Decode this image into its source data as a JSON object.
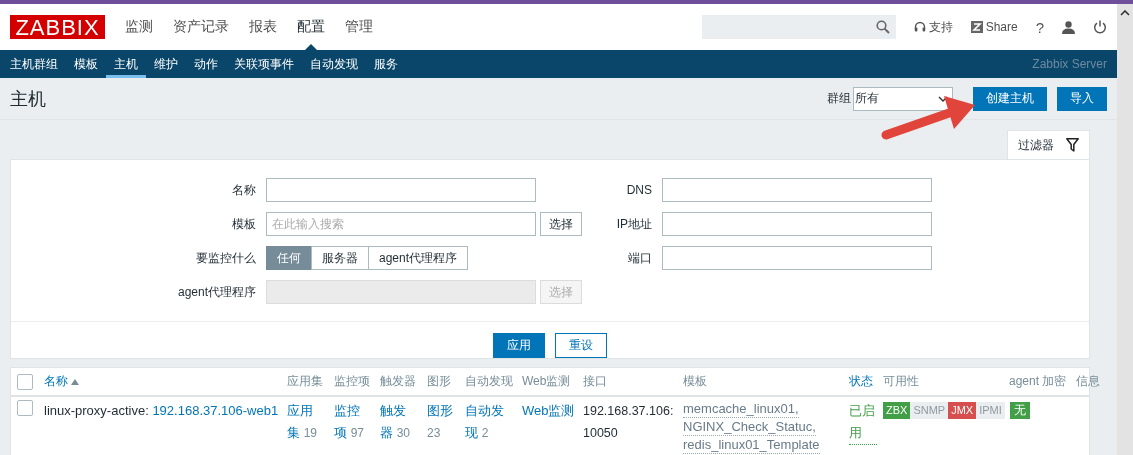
{
  "top_nav": {
    "logo": "ZABBIX",
    "menu": [
      {
        "label": "监测",
        "selected": false
      },
      {
        "label": "资产记录",
        "selected": false
      },
      {
        "label": "报表",
        "selected": false
      },
      {
        "label": "配置",
        "selected": true
      },
      {
        "label": "管理",
        "selected": false
      }
    ],
    "support": "支持",
    "share": "Share",
    "help": "?"
  },
  "sub_nav": {
    "items": [
      {
        "label": "主机群组",
        "selected": false
      },
      {
        "label": "模板",
        "selected": false
      },
      {
        "label": "主机",
        "selected": true
      },
      {
        "label": "维护",
        "selected": false
      },
      {
        "label": "动作",
        "selected": false
      },
      {
        "label": "关联项事件",
        "selected": false
      },
      {
        "label": "自动发现",
        "selected": false
      },
      {
        "label": "服务",
        "selected": false
      }
    ],
    "server_name": "Zabbix Server"
  },
  "page": {
    "title": "主机",
    "group_label": "群组",
    "group_value": "所有",
    "buttons": [
      "创建主机",
      "导入"
    ]
  },
  "filter": {
    "tab": "过滤器",
    "left": [
      {
        "kind": "text",
        "label": "名称"
      },
      {
        "kind": "picker",
        "label": "模板",
        "placeholder": "在此输入搜索",
        "button": "选择",
        "disabled": false
      },
      {
        "kind": "segments",
        "label": "要监控什么",
        "options": [
          {
            "label": "任何",
            "selected": true
          },
          {
            "label": "服务器",
            "selected": false
          },
          {
            "label": "agent代理程序",
            "selected": false
          }
        ]
      },
      {
        "kind": "picker",
        "label": "agent代理程序",
        "button": "选择",
        "disabled": true
      }
    ],
    "right": [
      {
        "kind": "text",
        "label": "DNS"
      },
      {
        "kind": "text",
        "label": "IP地址"
      },
      {
        "kind": "text",
        "label": "端口"
      }
    ],
    "apply": "应用",
    "reset": "重设"
  },
  "table": {
    "select_all_checked": false,
    "columns": [
      {
        "label": "名称",
        "sortable": true,
        "sorted": true
      },
      {
        "label": "应用集",
        "sortable": false,
        "sorted": false
      },
      {
        "label": "监控项",
        "sortable": false,
        "sorted": false
      },
      {
        "label": "触发器",
        "sortable": false,
        "sorted": false
      },
      {
        "label": "图形",
        "sortable": false,
        "sorted": false
      },
      {
        "label": "自动发现",
        "sortable": false,
        "sorted": false
      },
      {
        "label": "Web监测",
        "sortable": false,
        "sorted": false
      },
      {
        "label": "接口",
        "sortable": false,
        "sorted": false
      },
      {
        "label": "模板",
        "sortable": false,
        "sorted": false
      },
      {
        "label": "状态",
        "sortable": true,
        "sorted": false
      },
      {
        "label": "可用性",
        "sortable": false,
        "sorted": false
      },
      {
        "label": "agent 加密",
        "sortable": false,
        "sorted": false
      },
      {
        "label": "信息",
        "sortable": false,
        "sorted": false
      }
    ],
    "rows": [
      {
        "checked": false,
        "proxy": "linux-proxy-active:",
        "name": "192.168.37.106-web1",
        "counts": [
          {
            "label": "应用集",
            "count": "19"
          },
          {
            "label": "监控项",
            "count": "97"
          },
          {
            "label": "触发器",
            "count": "30"
          },
          {
            "label": "图形",
            "count": "23"
          },
          {
            "label": "自动发现",
            "count": "2"
          }
        ],
        "web": "Web监测",
        "interface": "192.168.37.106:10050",
        "templates": [
          "memcache_linux01,",
          "NGINX_Check_Statuc,",
          "redis_linux01_Template"
        ],
        "status": {
          "label": "已启用",
          "kind": "enabled"
        },
        "availability": [
          {
            "label": "ZBX",
            "color": "#429e47"
          },
          {
            "label": "SNMP",
            "color": "#ebeef0"
          },
          {
            "label": "JMX",
            "color": "#d64e4e"
          },
          {
            "label": "IPMI",
            "color": "#ebeef0"
          }
        ],
        "encryption": "无"
      }
    ]
  }
}
